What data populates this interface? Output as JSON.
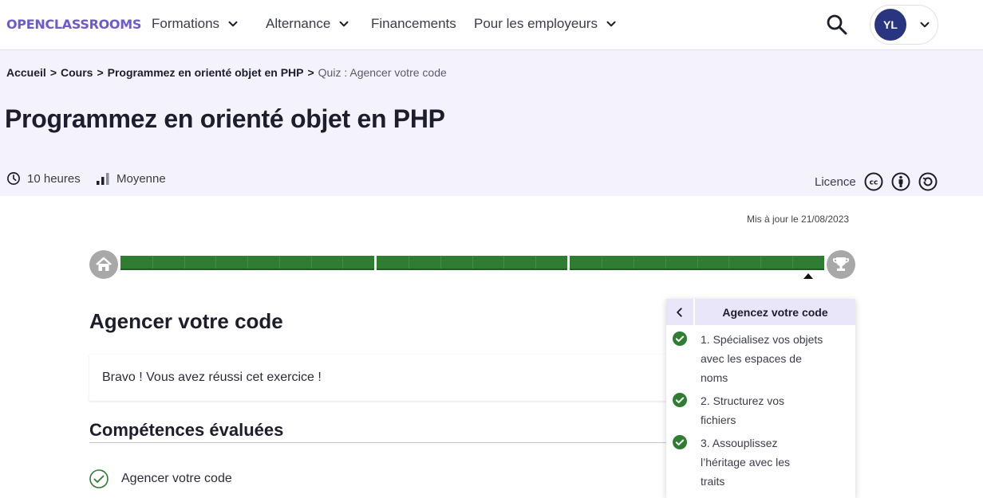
{
  "header": {
    "logo": "OPENCLASSROOMS",
    "nav": [
      {
        "label": "Formations",
        "has_dropdown": true
      },
      {
        "label": "Alternance",
        "has_dropdown": true
      },
      {
        "label": "Financements",
        "has_dropdown": false
      },
      {
        "label": "Pour les employeurs",
        "has_dropdown": true
      }
    ],
    "search_icon": "search-icon",
    "user_initials": "YL"
  },
  "breadcrumb": {
    "items": [
      "Accueil",
      "Cours",
      "Programmez en orienté objet en PHP"
    ],
    "separator": ">",
    "current": "Quiz : Agencer votre code"
  },
  "course": {
    "title": "Programmez en orienté objet en PHP",
    "duration": "10 heures",
    "level": "Moyenne",
    "licence_label": "Licence"
  },
  "updated": "Mis à jour le 21/08/2023",
  "progress": {
    "completed_fraction": 1.0,
    "color": "#2e7d32"
  },
  "quiz": {
    "title": "Agencer votre code",
    "success_message": "Bravo ! Vous avez réussi cet exercice !",
    "skills_title": "Compétences évaluées",
    "skills": [
      "Agencer votre code"
    ]
  },
  "toc": {
    "title": "Agencez votre code",
    "items": [
      {
        "label_lines": [
          "1. Spécialisez vos objets",
          "avec les espaces de",
          "noms"
        ],
        "done": true
      },
      {
        "label_lines": [
          "2. Structurez vos",
          "fichiers"
        ],
        "done": true
      },
      {
        "label_lines": [
          "3. Assouplissez",
          "l’héritage avec les",
          "traits"
        ],
        "done": true
      }
    ]
  },
  "colors": {
    "brand": "#6b5ad0",
    "hero_bg": "#f4f2fd",
    "success_green": "#2e7d32",
    "avatar_bg": "#2a3580"
  }
}
